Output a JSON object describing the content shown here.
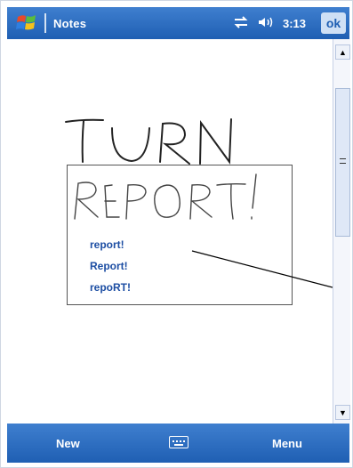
{
  "titlebar": {
    "app_title": "Notes",
    "time": "3:13",
    "ok_label": "ok"
  },
  "ink": {
    "top_word": "TURN",
    "recognized_word": "REPORT!"
  },
  "alternates": [
    "report!",
    "Report!",
    "repoRT!"
  ],
  "menubar": {
    "left": "New",
    "right": "Menu"
  },
  "icons": [
    "windows-start-icon",
    "connectivity-icon",
    "speaker-icon",
    "keyboard-icon",
    "scroll-up-icon",
    "scroll-down-icon"
  ],
  "colors": {
    "bar_blue": "#1f5fb3",
    "alt_text": "#1d4ea3"
  }
}
